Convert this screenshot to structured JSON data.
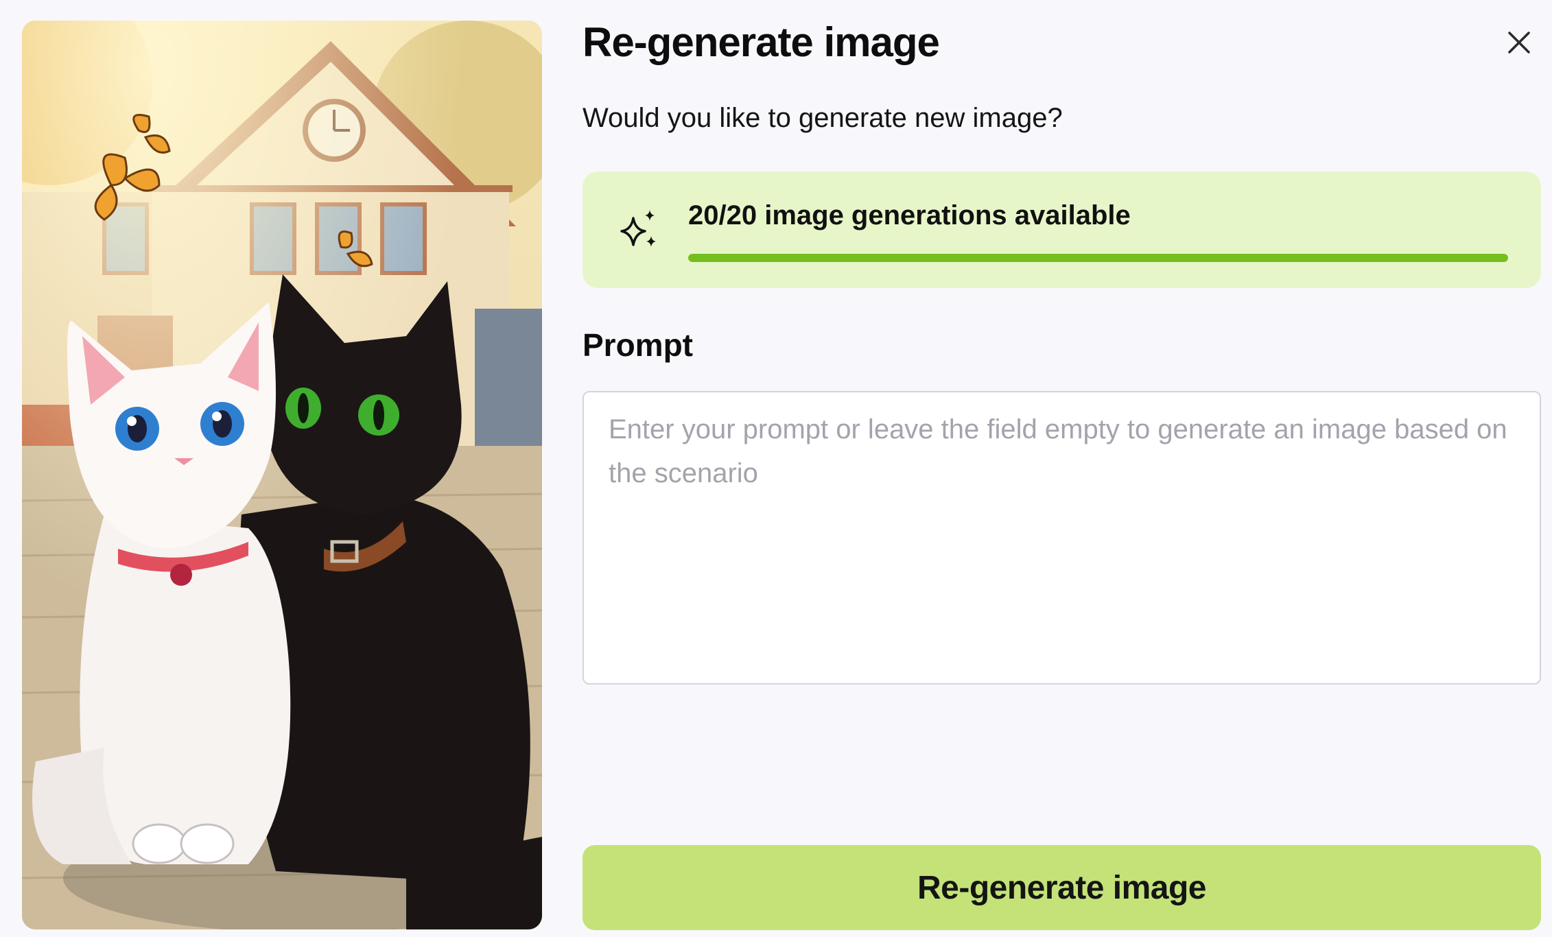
{
  "dialog": {
    "title": "Re-generate image",
    "subtitle": "Would you like to generate new image?",
    "close_icon": "close-icon"
  },
  "preview": {
    "icon": "image-preview"
  },
  "quota": {
    "icon": "sparkles-icon",
    "text": "20/20 image generations available",
    "used": 20,
    "total": 20,
    "fill_fraction": 1.0,
    "colors": {
      "card": "#e7f6c9",
      "bar": "#74bf1e"
    }
  },
  "prompt": {
    "label": "Prompt",
    "value": "",
    "placeholder": "Enter your prompt or leave the field empty to generate an image based on the scenario"
  },
  "actions": {
    "submit_label": "Re-generate image",
    "submit_color": "#c4e278"
  }
}
